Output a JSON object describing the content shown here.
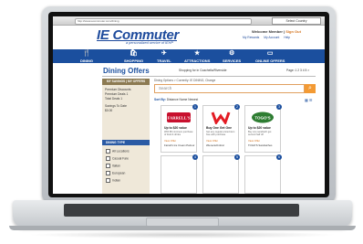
{
  "browser": {
    "url": "http://www.iecommuter.com/dining",
    "select_label": "Select Country"
  },
  "header": {
    "logo": "IE Commuter",
    "tagline": "a personalized service of IEHP",
    "welcome": "Welcome Member",
    "sign_in": "Sign Out",
    "links": [
      "My Rewards",
      "My Account",
      "Help"
    ]
  },
  "nav": {
    "items": [
      {
        "label": "DINING",
        "icon": "fork-knife-icon",
        "glyph": "🍴"
      },
      {
        "label": "SHOPPING",
        "icon": "shopping-bag-icon",
        "glyph": "🛍"
      },
      {
        "label": "TRAVEL",
        "icon": "airplane-icon",
        "glyph": "✈"
      },
      {
        "label": "ATTRACTIONS",
        "icon": "ticket-icon",
        "glyph": "★"
      },
      {
        "label": "SERVICES",
        "icon": "services-icon",
        "glyph": "⚙"
      },
      {
        "label": "ONLINE OFFERS",
        "icon": "monitor-icon",
        "glyph": "▭"
      }
    ]
  },
  "page": {
    "title": "Dining Offers",
    "shop_line": "Shopping for in Coachella/Riverside",
    "page_info": "Page: 1 2 3 4 5 >"
  },
  "sidebar": {
    "tabs": "MY SAVINGS | MY OFFERS",
    "lines": [
      "Premium Discounts",
      "Premium Deals 1",
      "Total Deals 1"
    ],
    "savings_label": "Savings To Date",
    "savings_value": "$0.00",
    "filter_header": "DINING TYPE",
    "filters": [
      "All Locations",
      "Casual Fare",
      "Italian",
      "European",
      "Indian"
    ]
  },
  "main": {
    "crumbs": "Dining Options > Currently: IE DINING, Change",
    "search_placeholder": "Search",
    "sort_label": "Sort By:",
    "sort_options": "Distance  Name  Newest",
    "cards": [
      {
        "num": "1",
        "logo_text": "FARRELL'S",
        "logo_color": "#c8102e",
        "title": "Up to $20 value",
        "sub": "With $5 minimum purchase of food & drinks",
        "link": "View Offer",
        "name": "Farrell's Ice Cream Parlour"
      },
      {
        "num": "2",
        "logo_text": "W",
        "logo_color": "#e31b23",
        "title": "Buy One Get One",
        "sub": "Get any regular priced item free with purchase",
        "link": "View Offer",
        "name": "Wienerschnitzel"
      },
      {
        "num": "3",
        "logo_text": "TOGO'S",
        "logo_color": "#2e7d32",
        "title": "Up to $20 value",
        "sub": "Buy one sandwich get second half off",
        "link": "View Offer",
        "name": "TOGO'S Sandwiches"
      },
      {
        "num": "4"
      },
      {
        "num": "5"
      },
      {
        "num": "6"
      }
    ]
  }
}
